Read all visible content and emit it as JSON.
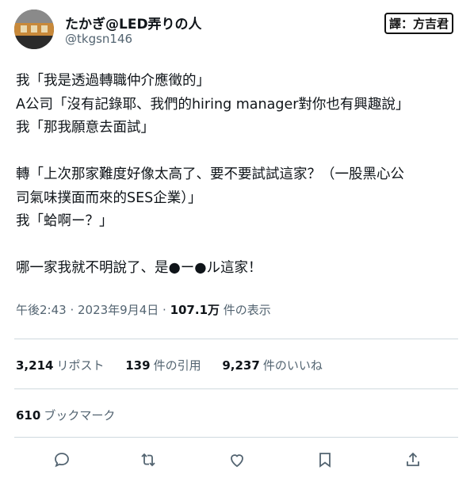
{
  "user": {
    "display_name": "たかぎ@LED弄りの人",
    "handle": "@tkgsn146"
  },
  "watermark": "譯：方吉君",
  "tweet": {
    "lines": [
      "我「我是透過轉職仲介應徵的」",
      "A公司「沒有記錄耶、我們的hiring manager對你也有興趣說」",
      "我「那我願意去面試」",
      "",
      "轉「上次那家難度好像太高了、要不要試試這家？（一股黑心公",
      "司氣味撲面而來的SES企業）」",
      "我「蛤啊ー？」",
      "",
      "哪一家我就不明說了、是●ー●ル這家！"
    ]
  },
  "meta": {
    "time": "午後2:43 · 2023年9月4日 · ",
    "views_count": "107.1万",
    "views_label": " 件の表示"
  },
  "stats": {
    "retweets_count": "3,214",
    "retweets_label": "リポスト",
    "quotes_count": "139",
    "quotes_label": "件の引用",
    "likes_count": "9,237",
    "likes_label": "件のいいね"
  },
  "bookmarks": {
    "count": "610",
    "label": "ブックマーク"
  },
  "actions": [
    "reply-icon",
    "retweet-icon",
    "like-icon",
    "bookmark-icon",
    "share-icon"
  ],
  "colors": {
    "text": "#0f1419",
    "secondary": "#536471",
    "divider": "#cfd9de"
  }
}
